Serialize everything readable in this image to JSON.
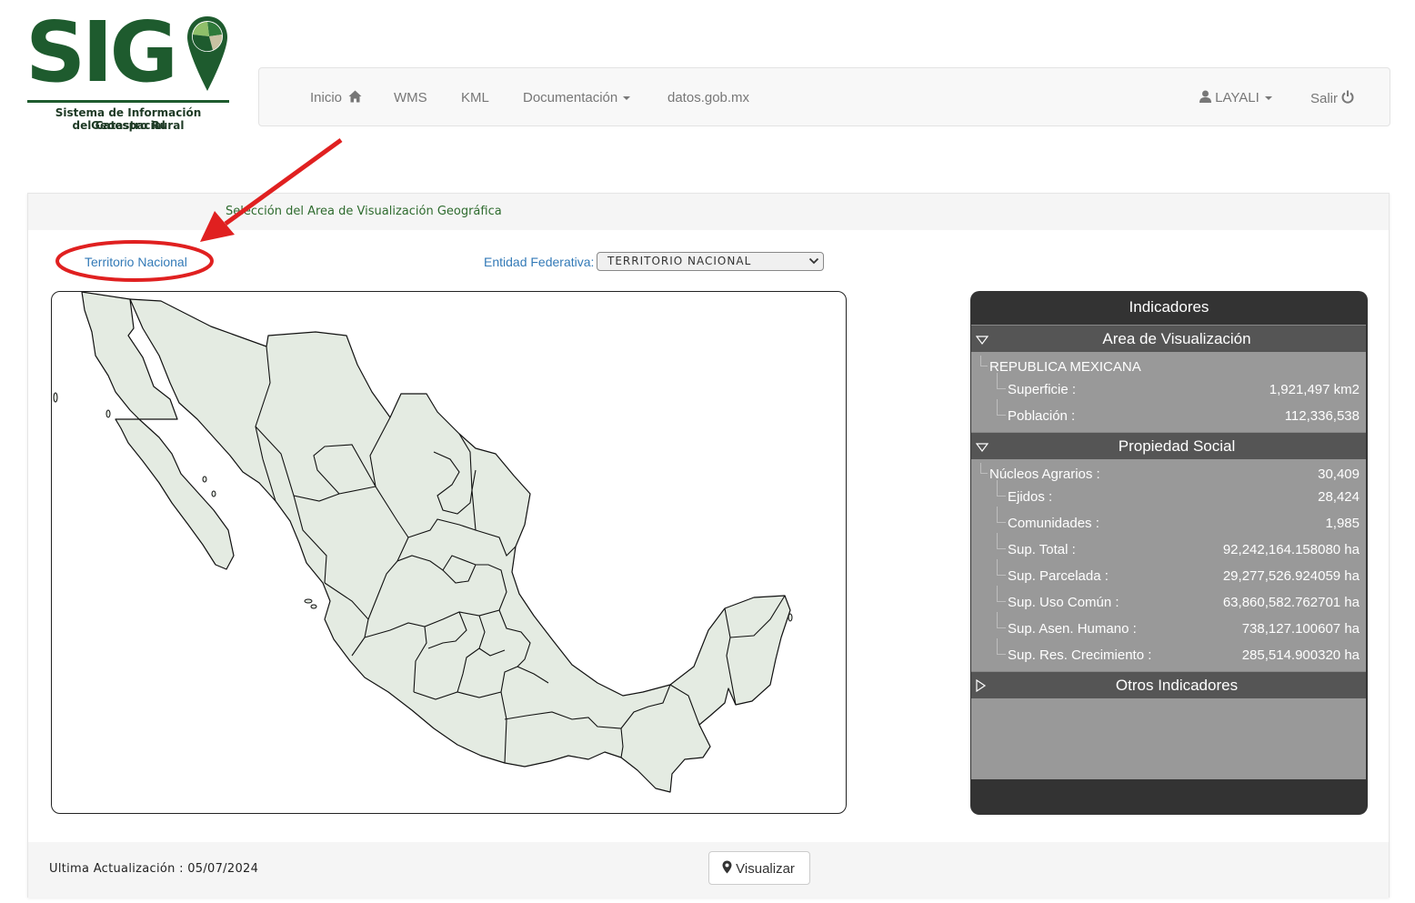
{
  "logo": {
    "text": "SIG",
    "subtitle_line1": "Sistema de Información Geoespacial",
    "subtitle_line2": "del Catastro Rural"
  },
  "nav": {
    "inicio": "Inicio",
    "wms": "WMS",
    "kml": "KML",
    "documentacion": "Documentación",
    "datos": "datos.gob.mx",
    "user": "LAYALI",
    "salir": "Salir"
  },
  "panel": {
    "title": "Selección del Area de Visualización Geográfica",
    "territorio_link": "Territorio Nacional",
    "entidad_label": "Entidad Federativa:",
    "entidad_selected": "TERRITORIO NACIONAL"
  },
  "indicadores": {
    "title": "Indicadores",
    "sections": {
      "area": "Area de Visualización",
      "propiedad": "Propiedad Social",
      "otros": "Otros Indicadores"
    },
    "area_name": "REPUBLICA MEXICANA",
    "area_rows": [
      {
        "label": "Superficie :",
        "value": "1,921,497 km2"
      },
      {
        "label": "Población :",
        "value": "112,336,538"
      }
    ],
    "nucleos": {
      "label": "Núcleos Agrarios :",
      "value": "30,409"
    },
    "propiedad_rows": [
      {
        "label": "Ejidos :",
        "value": "28,424"
      },
      {
        "label": "Comunidades :",
        "value": "1,985"
      },
      {
        "label": "Sup. Total :",
        "value": "92,242,164.158080 ha"
      },
      {
        "label": "Sup. Parcelada :",
        "value": "29,277,526.924059 ha"
      },
      {
        "label": "Sup. Uso Común :",
        "value": "63,860,582.762701 ha"
      },
      {
        "label": "Sup. Asen. Humano :",
        "value": "738,127.100607 ha"
      },
      {
        "label": "Sup. Res. Crecimiento :",
        "value": "285,514.900320 ha"
      }
    ]
  },
  "footer": {
    "update": "Ultima Actualización : 05/07/2024",
    "visualizar": "Visualizar"
  },
  "colors": {
    "brand_green": "#1e5b2e",
    "link_blue": "#337ab7",
    "annotation_red": "#e02020",
    "map_fill": "#e4ebe2"
  },
  "icons": [
    "home-icon",
    "caret-down-icon",
    "user-icon",
    "power-icon",
    "chevron-down-icon",
    "triangle-down-icon",
    "triangle-right-icon",
    "map-marker-icon",
    "location-pin-logo-icon"
  ]
}
